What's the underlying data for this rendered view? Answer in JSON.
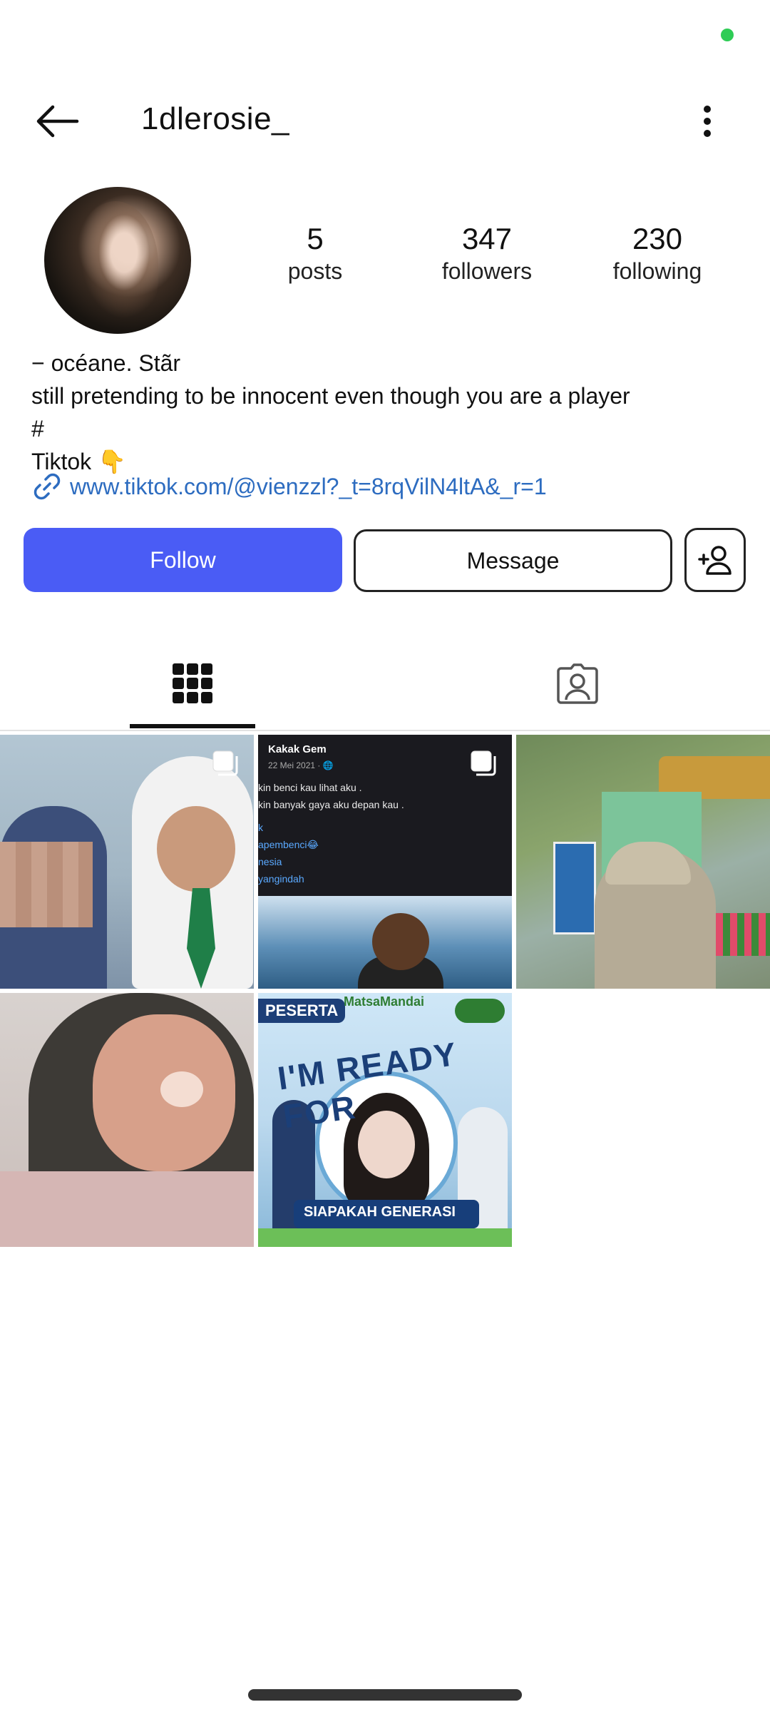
{
  "header": {
    "username": "1dlerosie_"
  },
  "stats": {
    "posts": {
      "value": "5",
      "label": "posts"
    },
    "followers": {
      "value": "347",
      "label": "followers"
    },
    "following": {
      "value": "230",
      "label": "following"
    }
  },
  "bio": {
    "lines": [
      "− océane. Stãr",
      "still pretending to be innocent even though you are a player",
      "#",
      "Tiktok 👇"
    ],
    "link": "www.tiktok.com/@vienzzl?_t=8rqVilN4ltA&_r=1"
  },
  "actions": {
    "follow_label": "Follow",
    "message_label": "Message"
  },
  "tabs": [
    {
      "icon": "grid-icon",
      "active": true
    },
    {
      "icon": "tagged-icon",
      "active": false
    }
  ],
  "posts": [
    {
      "kind": "multi-photo"
    },
    {
      "kind": "multi-photo",
      "title": "Kakak Gem",
      "date": "22 Mei 2021 · 🌐",
      "lines": [
        "kin benci kau lihat aku .",
        "kin banyak gaya aku depan kau ."
      ],
      "tags": [
        "k",
        "apembenci😂",
        "nesia",
        "yangindah"
      ]
    },
    {
      "kind": "photo"
    },
    {
      "kind": "photo"
    },
    {
      "kind": "photo",
      "badge": "PESERTA",
      "logo": "MatsaMandai",
      "headline": "I'M READY FOR",
      "footer": "SIAPAKAH GENERASI"
    }
  ],
  "colors": {
    "follow_button": "#4a5cf5",
    "link": "#2d6cc0",
    "status_dot": "#2ecc55"
  }
}
